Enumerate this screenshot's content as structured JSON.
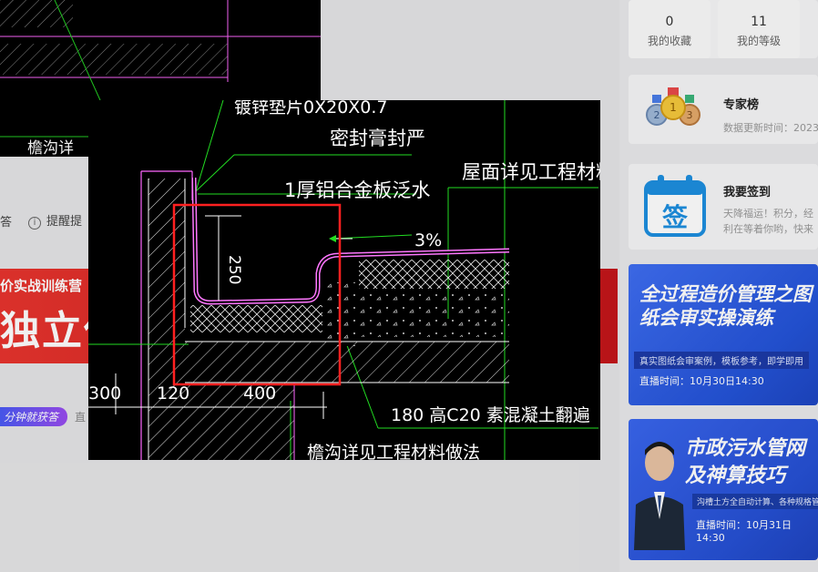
{
  "thumbnail": {
    "label": "檐沟详"
  },
  "actions": {
    "answer": "答",
    "remind": "提醒提"
  },
  "banner": {
    "sub": "价实战训练营",
    "main": "独立估"
  },
  "tags": {
    "fast_answer": "分钟就获答",
    "more": "直"
  },
  "stats": [
    {
      "value": "0",
      "label": "我的收藏"
    },
    {
      "value": "11",
      "label": "我的等级"
    }
  ],
  "experts": {
    "title": "专家榜",
    "updated": "数据更新时间：2023"
  },
  "checkin": {
    "title": "我要签到",
    "icon_char": "签",
    "desc_line1": "天降福运！积分，经",
    "desc_line2": "利在等着你哟，快来"
  },
  "promo1": {
    "title": "全过程造价管理之图纸会审实操演练",
    "desc": "真实图纸会审案例，模板参考，即学即用",
    "time": "直播时间：10月30日14:30"
  },
  "promo2": {
    "title": "市政污水管网及神算技巧",
    "desc": "沟槽土方全自动计算、各种规格管",
    "time": "直播时间：10月31日14:30"
  },
  "drawing": {
    "label_top_cut": "镀锌垫片0X20X0.7",
    "label_seal": "密封膏封严",
    "label_flashing": "1厚铝合金板泛水",
    "label_roof": "屋面详见工程材料",
    "label_slope": "3%",
    "label_height": "250",
    "dim_left": "300",
    "dim_120": "120",
    "dim_400": "400",
    "label_curb": "180  高C20  素混凝土翻遍",
    "label_gutter": "檐沟详见工程材料做法"
  }
}
